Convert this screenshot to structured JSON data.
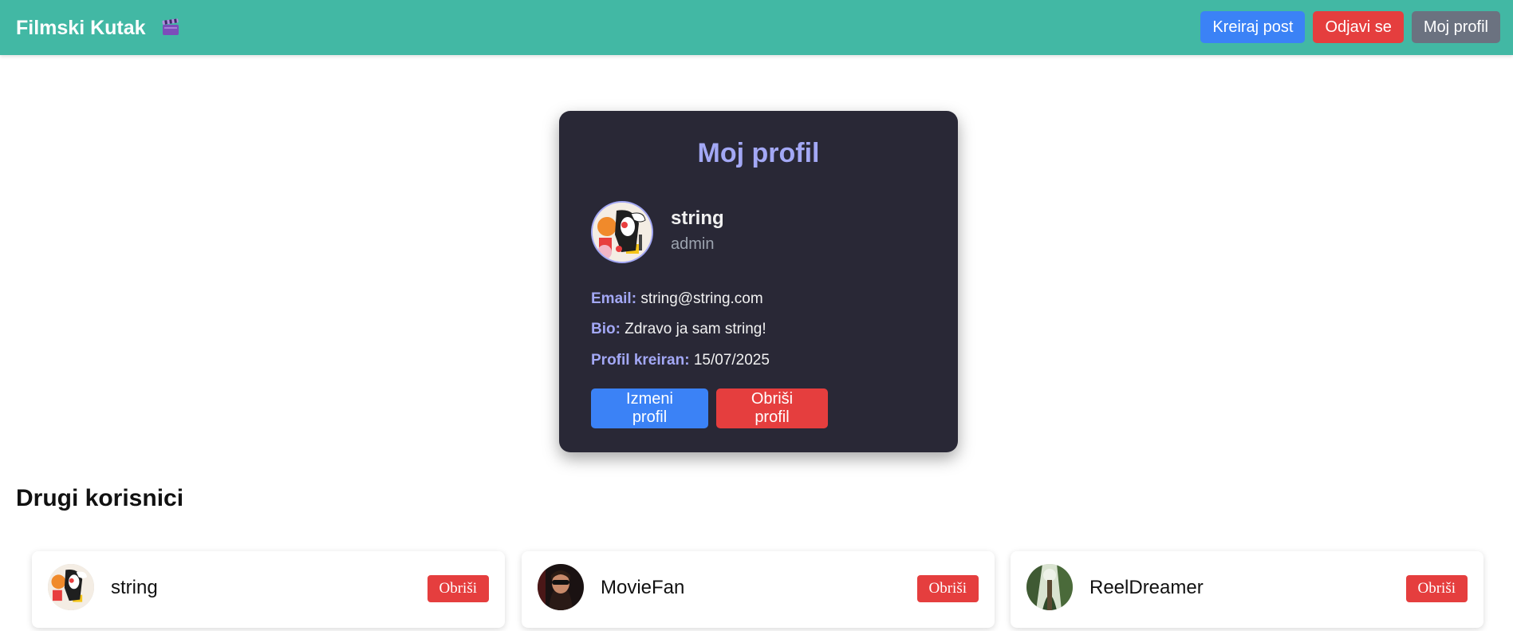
{
  "navbar": {
    "brand": "Filmski Kutak",
    "brand_icon": "clapperboard-icon",
    "buttons": {
      "create_post": "Kreiraj post",
      "logout": "Odjavi se",
      "my_profile": "Moj profil"
    }
  },
  "profile": {
    "title": "Moj profil",
    "username": "string",
    "role": "admin",
    "email_label": "Email:",
    "email": "string@string.com",
    "bio_label": "Bio:",
    "bio": "Zdravo ja sam string!",
    "created_label": "Profil kreiran:",
    "created": "15/07/2025",
    "edit_button": "Izmeni profil",
    "delete_button": "Obriši profil"
  },
  "others": {
    "title": "Drugi korisnici",
    "users": [
      {
        "name": "string",
        "delete_label": "Obriši"
      },
      {
        "name": "MovieFan",
        "delete_label": "Obriši"
      },
      {
        "name": "ReelDreamer",
        "delete_label": "Obriši"
      }
    ]
  },
  "colors": {
    "navbar": "#42b8a4",
    "primary": "#3b82f6",
    "danger": "#e53e3e",
    "secondary": "#6b7280",
    "card": "#292836",
    "accent": "#a3a8f5"
  }
}
